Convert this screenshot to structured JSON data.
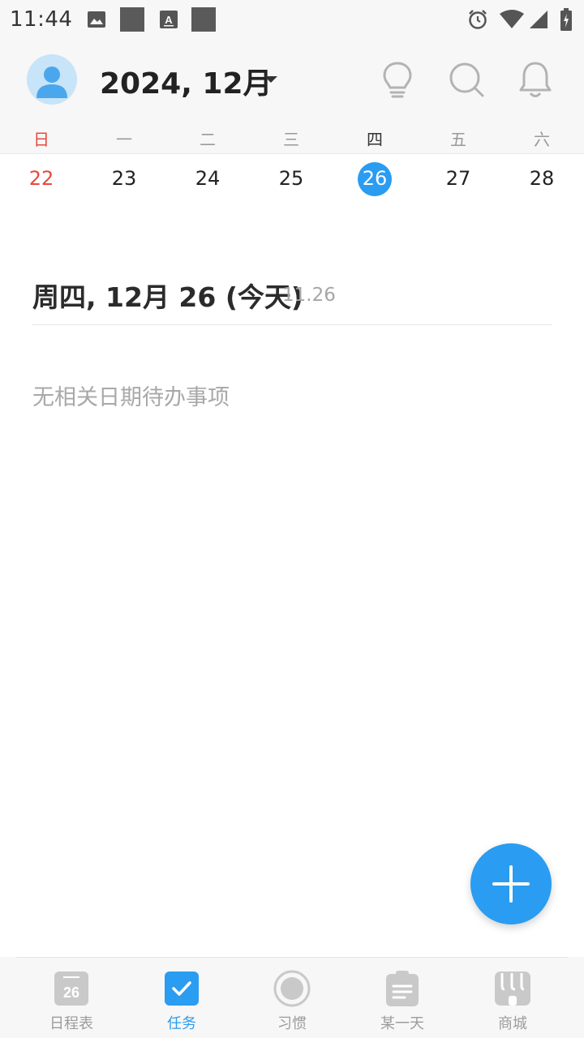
{
  "status_bar": {
    "time": "11:44",
    "left_icons": [
      "image-icon",
      "placeholder-square-icon",
      "text-a-icon",
      "placeholder-square-icon"
    ],
    "right_icons": [
      "alarm-icon",
      "wifi-icon",
      "cell-signal-icon",
      "battery-charging-icon"
    ]
  },
  "header": {
    "month_title": "2024, 12月",
    "buttons": [
      "lightbulb-icon",
      "search-icon",
      "bell-icon"
    ]
  },
  "week": {
    "weekdays": [
      "日",
      "一",
      "二",
      "三",
      "四",
      "五",
      "六"
    ],
    "dates": [
      "22",
      "23",
      "24",
      "25",
      "26",
      "27",
      "28"
    ],
    "selected_index": 4
  },
  "day": {
    "title": "周四, 12月 26 (今天)",
    "subtitle": "11.26",
    "empty_message": "无相关日期待办事项"
  },
  "bottom_nav": {
    "items": [
      {
        "label": "日程表",
        "icon": "calendar-icon",
        "icon_text": "26",
        "active": false
      },
      {
        "label": "任务",
        "icon": "checkbox-icon",
        "active": true
      },
      {
        "label": "习惯",
        "icon": "habit-circle-icon",
        "active": false
      },
      {
        "label": "某一天",
        "icon": "clipboard-icon",
        "active": false
      },
      {
        "label": "商城",
        "icon": "store-icon",
        "active": false
      }
    ]
  },
  "colors": {
    "accent": "#2a9cf1",
    "sunday": "#e8483c",
    "bar_background": "#f7f7f7"
  }
}
